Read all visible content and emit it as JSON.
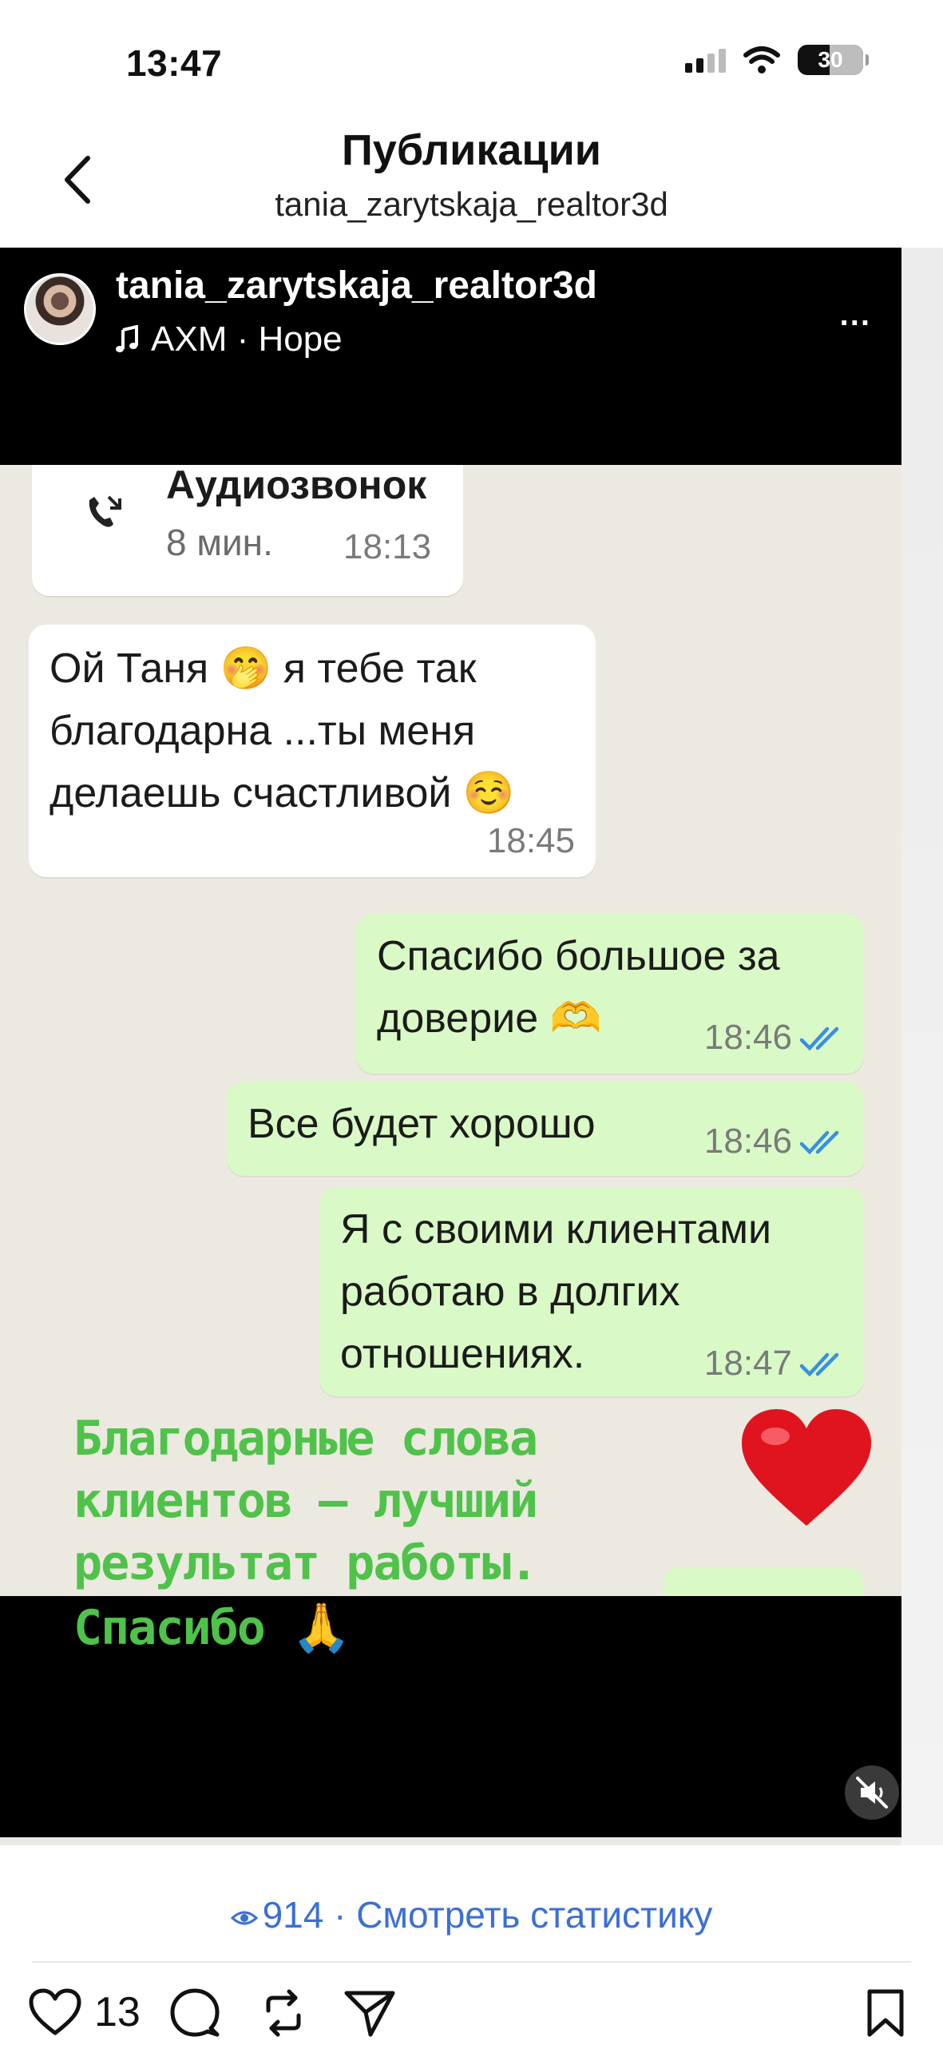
{
  "status_bar": {
    "time": "13:47",
    "battery": "30"
  },
  "header": {
    "title": "Публикации",
    "subtitle": "tania_zarytskaja_realtor3d"
  },
  "post": {
    "username": "tania_zarytskaja_realtor3d",
    "music": "AXM · Hope",
    "more": "...",
    "call": {
      "title": "Аудиозвонок",
      "duration": "8 мин.",
      "time": "18:13"
    },
    "messages": [
      {
        "lines": [
          "Ой Таня 🤭 я тебе так",
          "благодарна ...ты меня",
          "делаешь счастливой ☺️"
        ],
        "time": "18:45",
        "outgoing": false
      },
      {
        "lines": [
          "Спасибо большое за",
          "доверие 🫶"
        ],
        "time": "18:46",
        "outgoing": true
      },
      {
        "lines": [
          "Все будет хорошо"
        ],
        "time": "18:46",
        "outgoing": true
      },
      {
        "lines": [
          "Я с своими клиентами",
          "работаю в долгих",
          "отношениях."
        ],
        "time": "18:47",
        "outgoing": true
      }
    ],
    "overlay_lines": [
      "Благодарные слова",
      "клиентов — лучший",
      "результат работы."
    ],
    "overlay_last": "Спасибо 🙏"
  },
  "stats": {
    "views": "914",
    "link_text": "Смотреть статистику"
  },
  "actions": {
    "likes": "13"
  },
  "colors": {
    "link": "#3b6fd6",
    "outgoing_bubble": "#d9f9c6",
    "overlay_text": "#4fc24a"
  }
}
